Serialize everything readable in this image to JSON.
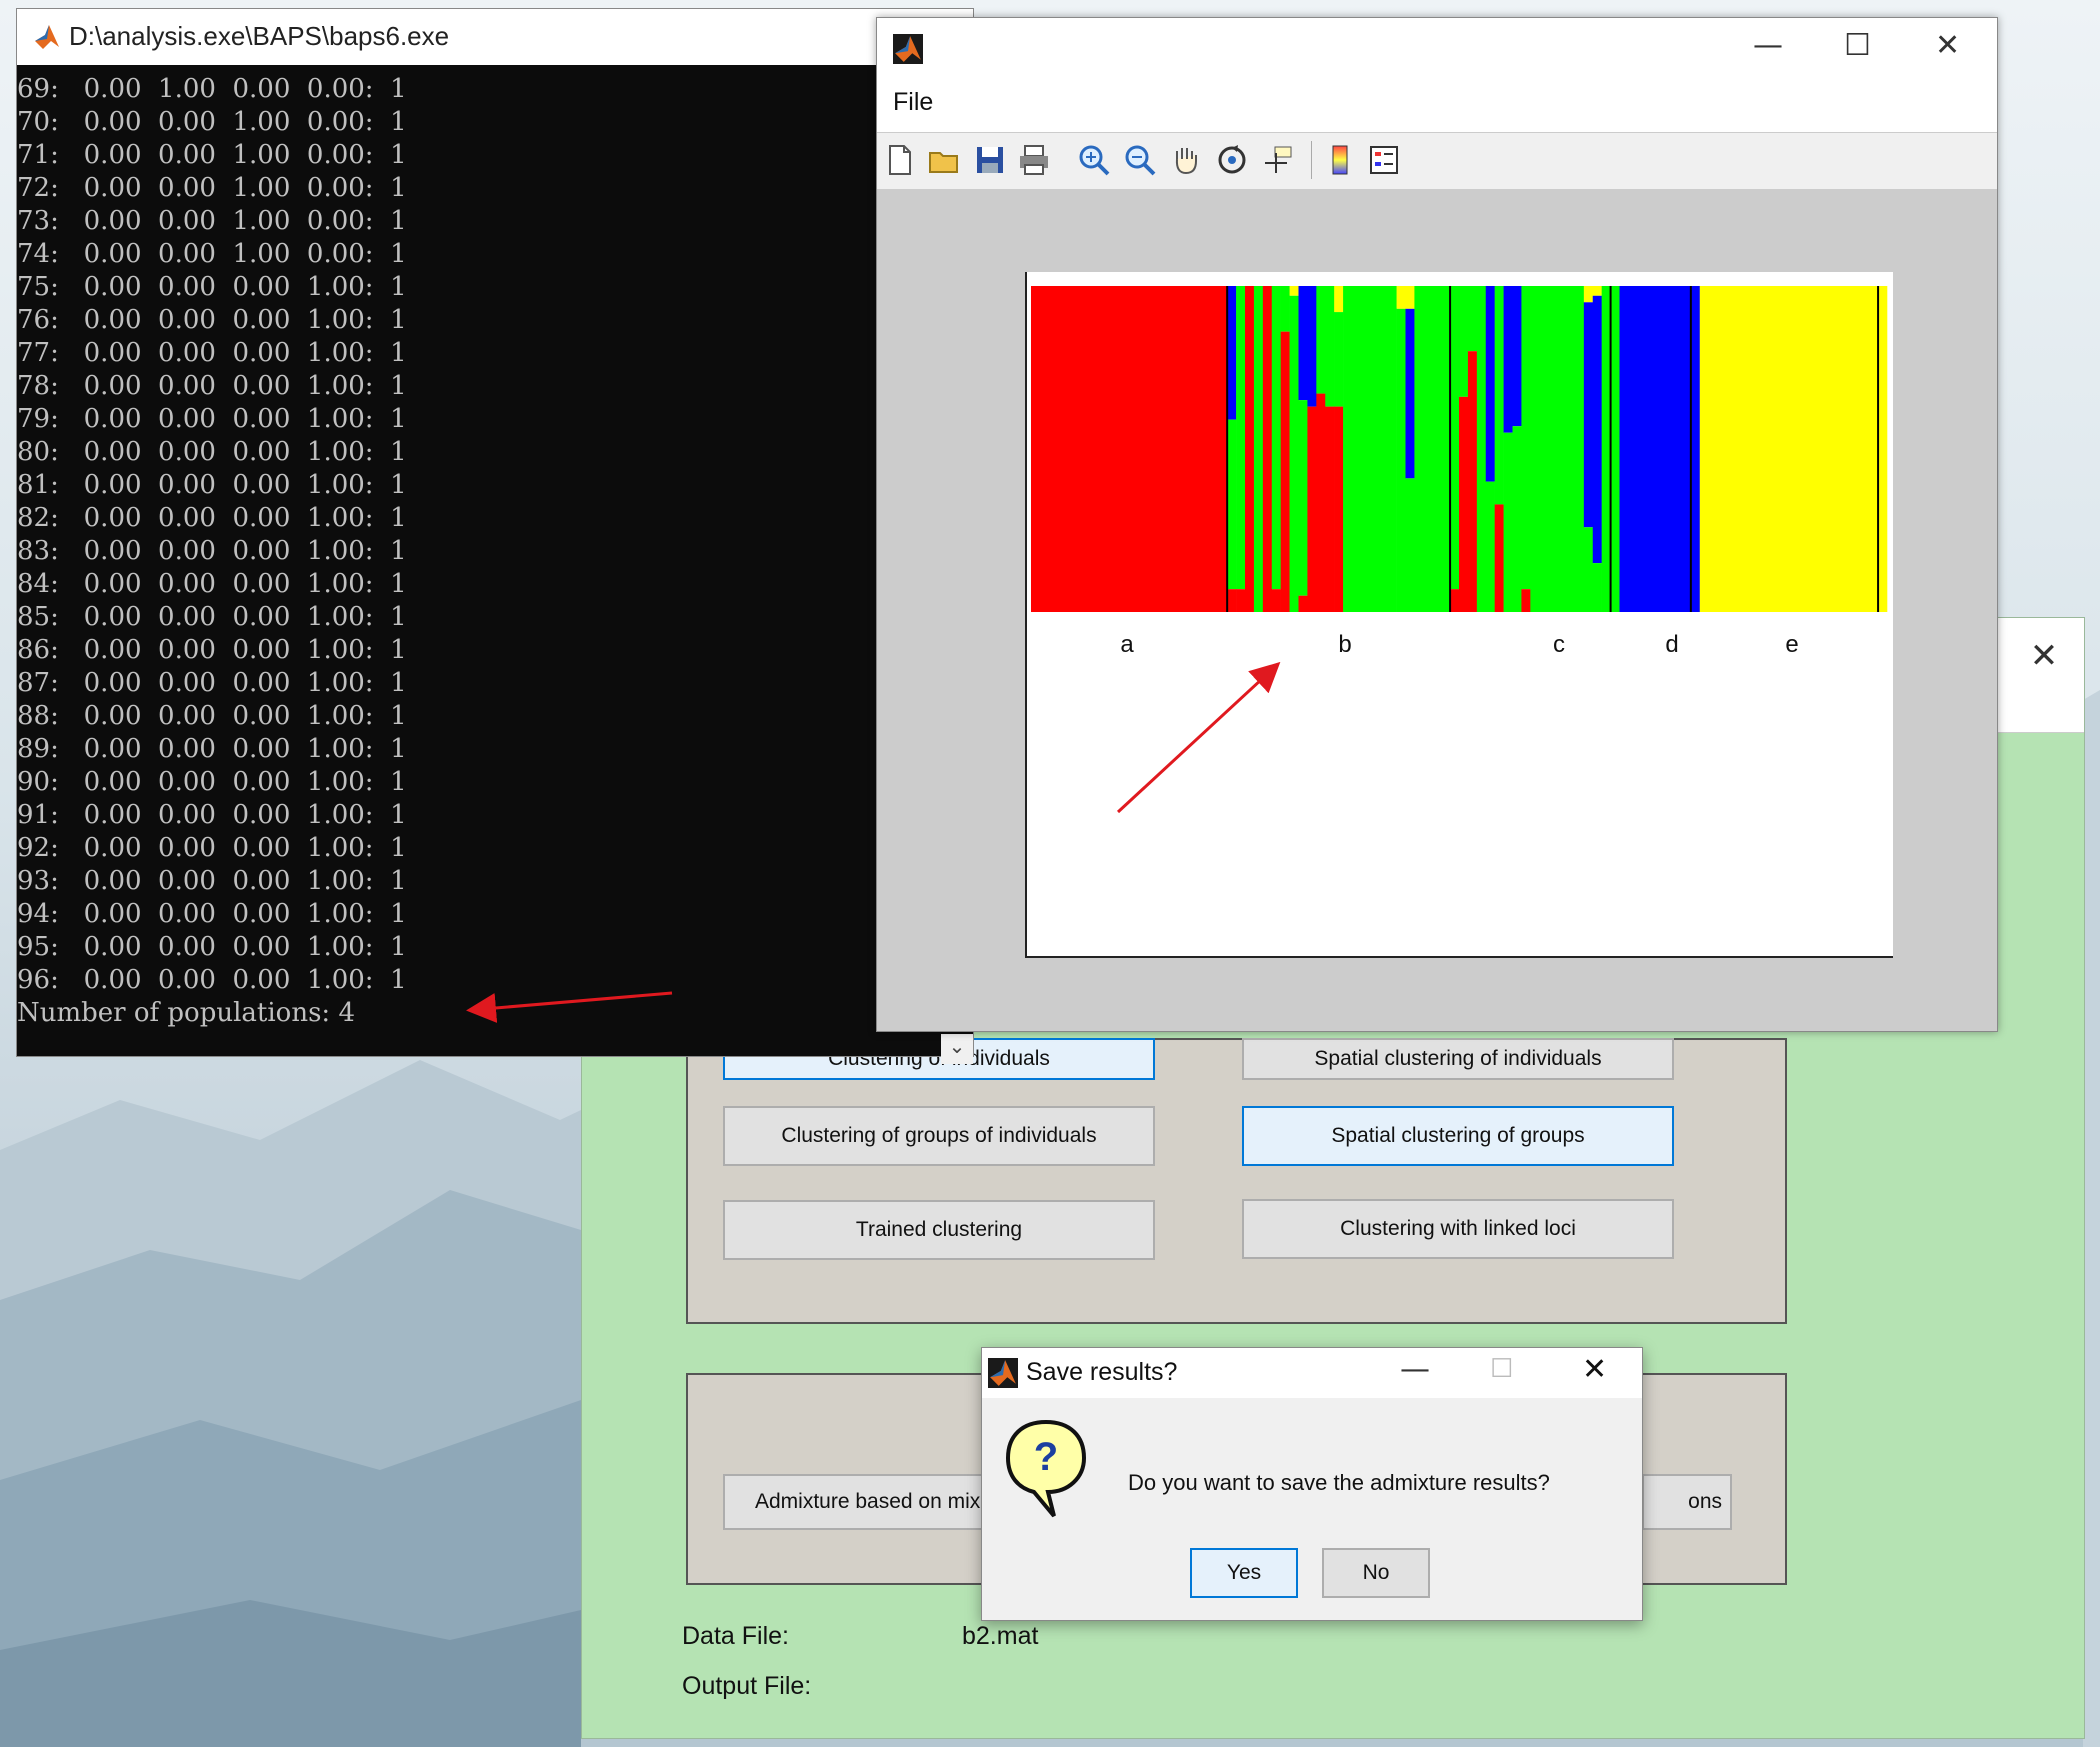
{
  "console": {
    "title": "D:\\analysis.exe\\BAPS\\baps6.exe",
    "lines": [
      "69:   0.00  1.00  0.00  0.00:  1",
      "70:   0.00  0.00  1.00  0.00:  1",
      "71:   0.00  0.00  1.00  0.00:  1",
      "72:   0.00  0.00  1.00  0.00:  1",
      "73:   0.00  0.00  1.00  0.00:  1",
      "74:   0.00  0.00  1.00  0.00:  1",
      "75:   0.00  0.00  0.00  1.00:  1",
      "76:   0.00  0.00  0.00  1.00:  1",
      "77:   0.00  0.00  0.00  1.00:  1",
      "78:   0.00  0.00  0.00  1.00:  1",
      "79:   0.00  0.00  0.00  1.00:  1",
      "80:   0.00  0.00  0.00  1.00:  1",
      "81:   0.00  0.00  0.00  1.00:  1",
      "82:   0.00  0.00  0.00  1.00:  1",
      "83:   0.00  0.00  0.00  1.00:  1",
      "84:   0.00  0.00  0.00  1.00:  1",
      "85:   0.00  0.00  0.00  1.00:  1",
      "86:   0.00  0.00  0.00  1.00:  1",
      "87:   0.00  0.00  0.00  1.00:  1",
      "88:   0.00  0.00  0.00  1.00:  1",
      "89:   0.00  0.00  0.00  1.00:  1",
      "90:   0.00  0.00  0.00  1.00:  1",
      "91:   0.00  0.00  0.00  1.00:  1",
      "92:   0.00  0.00  0.00  1.00:  1",
      "93:   0.00  0.00  0.00  1.00:  1",
      "94:   0.00  0.00  0.00  1.00:  1",
      "95:   0.00  0.00  0.00  1.00:  1",
      "96:   0.00  0.00  0.00  1.00:  1",
      "Number of populations: 4"
    ]
  },
  "figure": {
    "menu_file": "File",
    "toolbar_icons": [
      "new-file-icon",
      "open-folder-icon",
      "save-icon",
      "print-icon",
      "zoom-in-icon",
      "zoom-out-icon",
      "pan-hand-icon",
      "rotate-icon",
      "data-cursor-icon",
      "colorbar-icon",
      "legend-icon"
    ],
    "chart_data": {
      "type": "bar",
      "stacked": true,
      "group_labels": [
        "a",
        "b",
        "c",
        "d",
        "e"
      ],
      "ylim": [
        0,
        1
      ],
      "colors": {
        "red": "#ff0000",
        "green": "#00ff00",
        "blue": "#0000ff",
        "yellow": "#ffff00"
      },
      "bars": [
        {
          "n": 22,
          "red": 1.0,
          "green": 0.0,
          "blue": 0.0,
          "yellow": 0.0
        },
        {
          "n": 1,
          "red": 0.07,
          "green": 0.52,
          "blue": 0.41,
          "yellow": 0.0
        },
        {
          "n": 1,
          "red": 0.07,
          "green": 0.93,
          "blue": 0.0,
          "yellow": 0.0
        },
        {
          "n": 1,
          "red": 1.0,
          "green": 0.0,
          "blue": 0.0,
          "yellow": 0.0
        },
        {
          "n": 1,
          "red": 0.0,
          "green": 1.0,
          "blue": 0.0,
          "yellow": 0.0
        },
        {
          "n": 1,
          "red": 1.0,
          "green": 0.0,
          "blue": 0.0,
          "yellow": 0.0
        },
        {
          "n": 1,
          "red": 0.07,
          "green": 0.93,
          "blue": 0.0,
          "yellow": 0.0
        },
        {
          "n": 1,
          "red": 0.86,
          "green": 0.14,
          "blue": 0.0,
          "yellow": 0.0
        },
        {
          "n": 1,
          "red": 0.0,
          "green": 0.97,
          "blue": 0.0,
          "yellow": 0.03
        },
        {
          "n": 1,
          "red": 0.05,
          "green": 0.6,
          "blue": 0.35,
          "yellow": 0.0
        },
        {
          "n": 1,
          "red": 0.63,
          "green": 0.0,
          "blue": 0.37,
          "yellow": 0.0
        },
        {
          "n": 1,
          "red": 0.67,
          "green": 0.33,
          "blue": 0.0,
          "yellow": 0.0
        },
        {
          "n": 1,
          "red": 0.63,
          "green": 0.37,
          "blue": 0.0,
          "yellow": 0.0
        },
        {
          "n": 1,
          "red": 0.63,
          "green": 0.29,
          "blue": 0.0,
          "yellow": 0.08
        },
        {
          "n": 1,
          "red": 0.0,
          "green": 1.0,
          "blue": 0.0,
          "yellow": 0.0
        },
        {
          "n": 5,
          "red": 0.0,
          "green": 1.0,
          "blue": 0.0,
          "yellow": 0.0
        },
        {
          "n": 1,
          "red": 0.0,
          "green": 0.93,
          "blue": 0.0,
          "yellow": 0.07
        },
        {
          "n": 1,
          "red": 0.0,
          "green": 0.41,
          "blue": 0.52,
          "yellow": 0.07
        },
        {
          "n": 4,
          "red": 0.0,
          "green": 1.0,
          "blue": 0.0,
          "yellow": 0.0
        },
        {
          "n": 1,
          "red": 0.07,
          "green": 0.93,
          "blue": 0.0,
          "yellow": 0.0
        },
        {
          "n": 1,
          "red": 0.66,
          "green": 0.34,
          "blue": 0.0,
          "yellow": 0.0
        },
        {
          "n": 1,
          "red": 0.8,
          "green": 0.2,
          "blue": 0.0,
          "yellow": 0.0
        },
        {
          "n": 1,
          "red": 0.0,
          "green": 1.0,
          "blue": 0.0,
          "yellow": 0.0
        },
        {
          "n": 1,
          "red": 0.0,
          "green": 0.4,
          "blue": 0.6,
          "yellow": 0.0
        },
        {
          "n": 1,
          "red": 0.33,
          "green": 0.67,
          "blue": 0.0,
          "yellow": 0.0
        },
        {
          "n": 1,
          "red": 0.0,
          "green": 0.55,
          "blue": 0.45,
          "yellow": 0.0
        },
        {
          "n": 1,
          "red": 0.0,
          "green": 0.57,
          "blue": 0.43,
          "yellow": 0.0
        },
        {
          "n": 1,
          "red": 0.07,
          "green": 0.93,
          "blue": 0.0,
          "yellow": 0.0
        },
        {
          "n": 6,
          "red": 0.0,
          "green": 1.0,
          "blue": 0.0,
          "yellow": 0.0
        },
        {
          "n": 1,
          "red": 0.0,
          "green": 0.26,
          "blue": 0.69,
          "yellow": 0.05
        },
        {
          "n": 1,
          "red": 0.0,
          "green": 0.15,
          "blue": 0.82,
          "yellow": 0.03
        },
        {
          "n": 1,
          "red": 0.0,
          "green": 1.0,
          "blue": 0.0,
          "yellow": 0.0
        },
        {
          "n": 1,
          "red": 0.0,
          "green": 1.0,
          "blue": 0.0,
          "yellow": 0.0
        },
        {
          "n": 9,
          "red": 0.0,
          "green": 0.0,
          "blue": 1.0,
          "yellow": 0.0
        },
        {
          "n": 21,
          "red": 0.0,
          "green": 0.0,
          "blue": 0.0,
          "yellow": 1.0
        }
      ]
    }
  },
  "baps": {
    "buttons": {
      "clustering_individuals": "Clustering of individuals",
      "spatial_clustering_individuals": "Spatial clustering of individuals",
      "clustering_groups": "Clustering of groups of individuals",
      "spatial_clustering_groups": "Spatial clustering of groups",
      "trained_clustering": "Trained clustering",
      "linked_loci": "Clustering with linked loci",
      "admixture_mixture": "Admixture based on mix",
      "admixture_right": "ons"
    },
    "data_file_label": "Data File:",
    "data_file_value": "b2.mat",
    "output_file_label": "Output File:"
  },
  "dialog": {
    "title": "Save results?",
    "message": "Do you want to save the admixture results?",
    "yes": "Yes",
    "no": "No"
  },
  "colors": {
    "annotation_arrow": "#e0191f",
    "accent": "#0078d7"
  }
}
